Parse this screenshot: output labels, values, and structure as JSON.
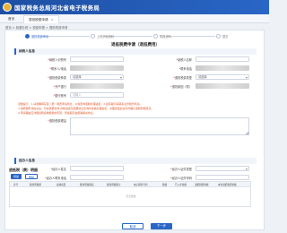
{
  "header": {
    "site_title": "国家税务总局河北省电子税务局"
  },
  "tabs": [
    {
      "label": "首页"
    },
    {
      "label": "退抵税费申请"
    }
  ],
  "breadcrumb": "首页 > 我要办税 > 税费申报 > 退抵税费申请",
  "steps": [
    {
      "label": "退抵税费申请"
    },
    {
      "label": "上传申请资料"
    },
    {
      "label": "附报资料"
    },
    {
      "label": "提交"
    }
  ],
  "form": {
    "title": "退抵税费申请（退抵费用）",
    "section_taxpayer": "纳税人信息",
    "fields": {
      "taxpayer_id_label": "纳税人识别号",
      "taxpayer_name_label": "纳税人名称",
      "contact_label": "联系人/电话",
      "phone_label": "联系电话",
      "nature_label": "退抵税费种类",
      "nature_value": "请选择",
      "refund_type_label": "退抵税费类型",
      "refund_type_value": "请选择",
      "bank_label": "开户银行",
      "refund_reason_label": "退抵原因（附）",
      "account_label": "银行账号",
      "account_placeholder": "请输入"
    },
    "notes": [
      "温馨提示：1.请准确填写退（抵）税费申请信息，以免影响退税办理进度；2.如有疑问请联系主管税务机关。",
      "3.退抵税申请提交后，可在我要查询-办税进度及结果信息查询中查看办理进度，办理完结后请及时确认退税到账情况。",
      "4.申请理由应详细说明多缴税费的原因、所属期及金额等相关信息。"
    ],
    "reason_label": "退抵税费理由",
    "section_agent": "经办人信息",
    "agent_fields": {
      "agent_name_label": "经办人姓名",
      "agent_id_type_label": "经办人证件类型",
      "agent_phone_label": "经办人联系电话",
      "agent_id_label": "经办人证件号码"
    }
  },
  "table": {
    "title": "退抵税（费）明细",
    "buttons": [
      "增加",
      "删除"
    ],
    "headers": [
      "序号",
      "税款所属期",
      "征收项目",
      "税款所属期起",
      "税款所属期止",
      "电子税票号码",
      "税额",
      "已入库金额",
      "退抵税费金额",
      "本次退抵税费金额"
    ],
    "empty_text": "暂无数据"
  },
  "footer": {
    "prev_label": "取消",
    "next_label": "下一步"
  },
  "colors": {
    "primary": "#2a66c6",
    "topbar": "#1d4fa3",
    "warning": "#e0572b"
  }
}
